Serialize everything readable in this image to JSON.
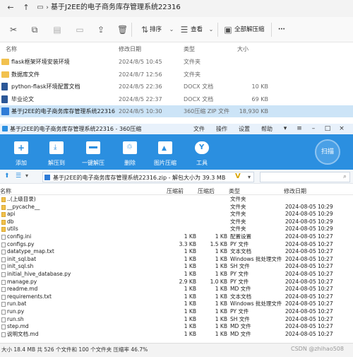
{
  "explorer": {
    "address": "基于J2EE的电子商务库存管理系统22316",
    "toolbar": {
      "sort_label": "排序",
      "view_label": "查看",
      "extract_label": "全部解压缩",
      "more_label": "···"
    },
    "columns": [
      "名称",
      "修改日期",
      "类型",
      "大小"
    ],
    "files": [
      {
        "name": "flask框架环境安装环境",
        "date": "2024/8/5 10:45",
        "type": "文件夹",
        "size": "",
        "kind": "folder"
      },
      {
        "name": "数据库文件",
        "date": "2024/8/7 12:56",
        "type": "文件夹",
        "size": "",
        "kind": "folder"
      },
      {
        "name": "python-flask环境配置文档",
        "date": "2024/8/5 22:36",
        "type": "DOCX 文档",
        "size": "10 KB",
        "kind": "doc"
      },
      {
        "name": "毕业论文",
        "date": "2024/8/5 22:37",
        "type": "DOCX 文档",
        "size": "69 KB",
        "kind": "doc"
      },
      {
        "name": "基于J2EE的电子商务库存管理系统22316",
        "date": "2024/8/5 10:30",
        "type": "360压缩 ZIP 文件",
        "size": "18,930 KB",
        "kind": "zip"
      }
    ]
  },
  "zip_window": {
    "title": "基于J2EE的电子商务库存管理系统22316 - 360压缩",
    "menu": [
      "文件",
      "操作",
      "设置",
      "帮助"
    ],
    "toolbar": [
      "添加",
      "解压到",
      "一键解压",
      "删除",
      "图片压缩",
      "工具"
    ],
    "scan_label": "扫描",
    "path_text": "基于J2EE的电子商务库存管理系统22316.zip - 解包大小为 39.3 MB",
    "columns": [
      "名称",
      "压缩前",
      "压缩后",
      "类型",
      "修改日期"
    ],
    "rows": [
      {
        "name": "..(上级目录)",
        "before": "",
        "after": "",
        "type": "文件夹",
        "date": "",
        "kind": "folder"
      },
      {
        "name": "__pycache__",
        "before": "",
        "after": "",
        "type": "文件夹",
        "date": "2024-08-05 10:29",
        "kind": "folder"
      },
      {
        "name": "api",
        "before": "",
        "after": "",
        "type": "文件夹",
        "date": "2024-08-05 10:29",
        "kind": "folder"
      },
      {
        "name": "db",
        "before": "",
        "after": "",
        "type": "文件夹",
        "date": "2024-08-05 10:29",
        "kind": "folder"
      },
      {
        "name": "utils",
        "before": "",
        "after": "",
        "type": "文件夹",
        "date": "2024-08-05 10:29",
        "kind": "folder"
      },
      {
        "name": "config.ini",
        "before": "1 KB",
        "after": "1 KB",
        "type": "配置设置",
        "date": "2024-08-05 10:27",
        "kind": "file"
      },
      {
        "name": "configs.py",
        "before": "3.3 KB",
        "after": "1.5 KB",
        "type": "PY 文件",
        "date": "2024-08-05 10:27",
        "kind": "file"
      },
      {
        "name": "datatype_map.txt",
        "before": "1 KB",
        "after": "1 KB",
        "type": "文本文档",
        "date": "2024-08-05 10:27",
        "kind": "file"
      },
      {
        "name": "init_sql.bat",
        "before": "1 KB",
        "after": "1 KB",
        "type": "Windows 批处理文件",
        "date": "2024-08-05 10:27",
        "kind": "file"
      },
      {
        "name": "init_sql.sh",
        "before": "1 KB",
        "after": "1 KB",
        "type": "SH 文件",
        "date": "2024-08-05 10:27",
        "kind": "file"
      },
      {
        "name": "initial_hive_database.py",
        "before": "1 KB",
        "after": "1 KB",
        "type": "PY 文件",
        "date": "2024-08-05 10:27",
        "kind": "file"
      },
      {
        "name": "manage.py",
        "before": "2.9 KB",
        "after": "1.0 KB",
        "type": "PY 文件",
        "date": "2024-08-05 10:27",
        "kind": "file"
      },
      {
        "name": "readme.md",
        "before": "1 KB",
        "after": "1 KB",
        "type": "MD 文件",
        "date": "2024-08-05 10:27",
        "kind": "file"
      },
      {
        "name": "requirements.txt",
        "before": "1 KB",
        "after": "1 KB",
        "type": "文本文档",
        "date": "2024-08-05 10:27",
        "kind": "file"
      },
      {
        "name": "run.bat",
        "before": "1 KB",
        "after": "1 KB",
        "type": "Windows 批处理文件",
        "date": "2024-08-05 10:27",
        "kind": "file"
      },
      {
        "name": "run.py",
        "before": "1 KB",
        "after": "1 KB",
        "type": "PY 文件",
        "date": "2024-08-05 10:27",
        "kind": "file"
      },
      {
        "name": "run.sh",
        "before": "1 KB",
        "after": "1 KB",
        "type": "SH 文件",
        "date": "2024-08-05 10:27",
        "kind": "file"
      },
      {
        "name": "step.md",
        "before": "1 KB",
        "after": "1 KB",
        "type": "MD 文件",
        "date": "2024-08-05 10:27",
        "kind": "file"
      },
      {
        "name": "说明文档.md",
        "before": "1 KB",
        "after": "1 KB",
        "type": "MD 文件",
        "date": "2024-08-05 10:27",
        "kind": "file"
      }
    ],
    "status": "大小 18.4 MB 共 526 个文件和 100 个文件夹 压缩率 46.7%",
    "watermark": "CSDN @zhihao508"
  }
}
